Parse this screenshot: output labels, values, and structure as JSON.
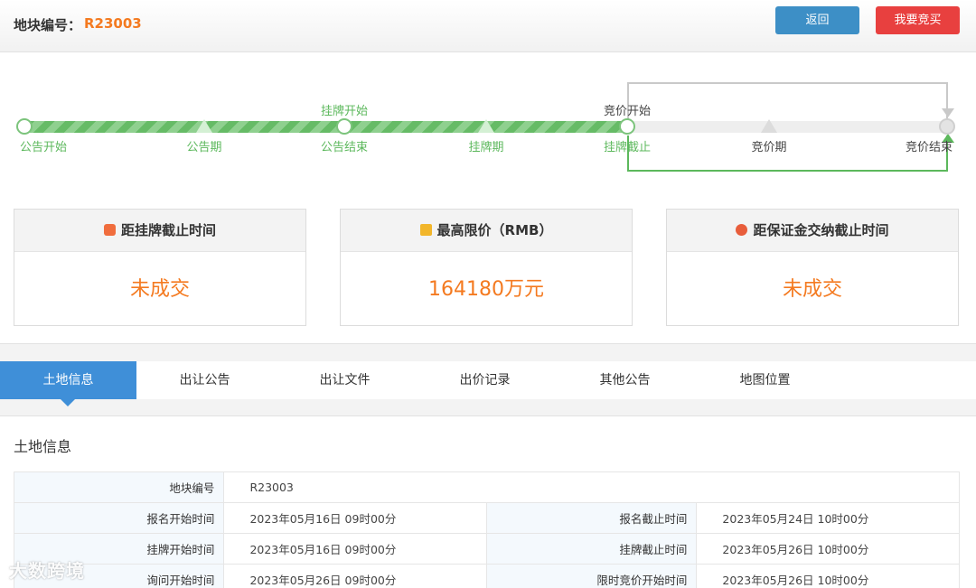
{
  "header": {
    "plot_label": "地块编号：",
    "plot_code": "R23003",
    "back_label": "返回",
    "bid_label": "我要竞买"
  },
  "timeline": {
    "labels": {
      "gonggao_start": "公告开始",
      "gonggao_period": "公告期",
      "gonggao_end": "公告结束",
      "guapai_start": "挂牌开始",
      "guapai_period": "挂牌期",
      "guapai_end": "挂牌截止",
      "jingjia_start": "竞价开始",
      "jingjia_period": "竞价期",
      "jingjia_end": "竞价结束"
    }
  },
  "cards": [
    {
      "title": "距挂牌截止时间",
      "value": "未成交"
    },
    {
      "title": "最高限价（RMB）",
      "value": "164180万元"
    },
    {
      "title": "距保证金交纳截止时间",
      "value": "未成交"
    }
  ],
  "tabs": [
    "土地信息",
    "出让公告",
    "出让文件",
    "出价记录",
    "其他公告",
    "地图位置"
  ],
  "section_title": "土地信息",
  "table": {
    "plot_no_label": "地块编号",
    "plot_no_value": "R23003",
    "rows": [
      {
        "l1": "报名开始时间",
        "v1": "2023年05月16日 09时00分",
        "l2": "报名截止时间",
        "v2": "2023年05月24日 10时00分"
      },
      {
        "l1": "挂牌开始时间",
        "v1": "2023年05月16日 09时00分",
        "l2": "挂牌截止时间",
        "v2": "2023年05月26日 10时00分"
      },
      {
        "l1": "询问开始时间",
        "v1": "2023年05月26日 09时00分",
        "l2": "限时竞价开始时间",
        "v2": "2023年05月26日 10时00分"
      }
    ]
  },
  "watermark": "大数跨境"
}
